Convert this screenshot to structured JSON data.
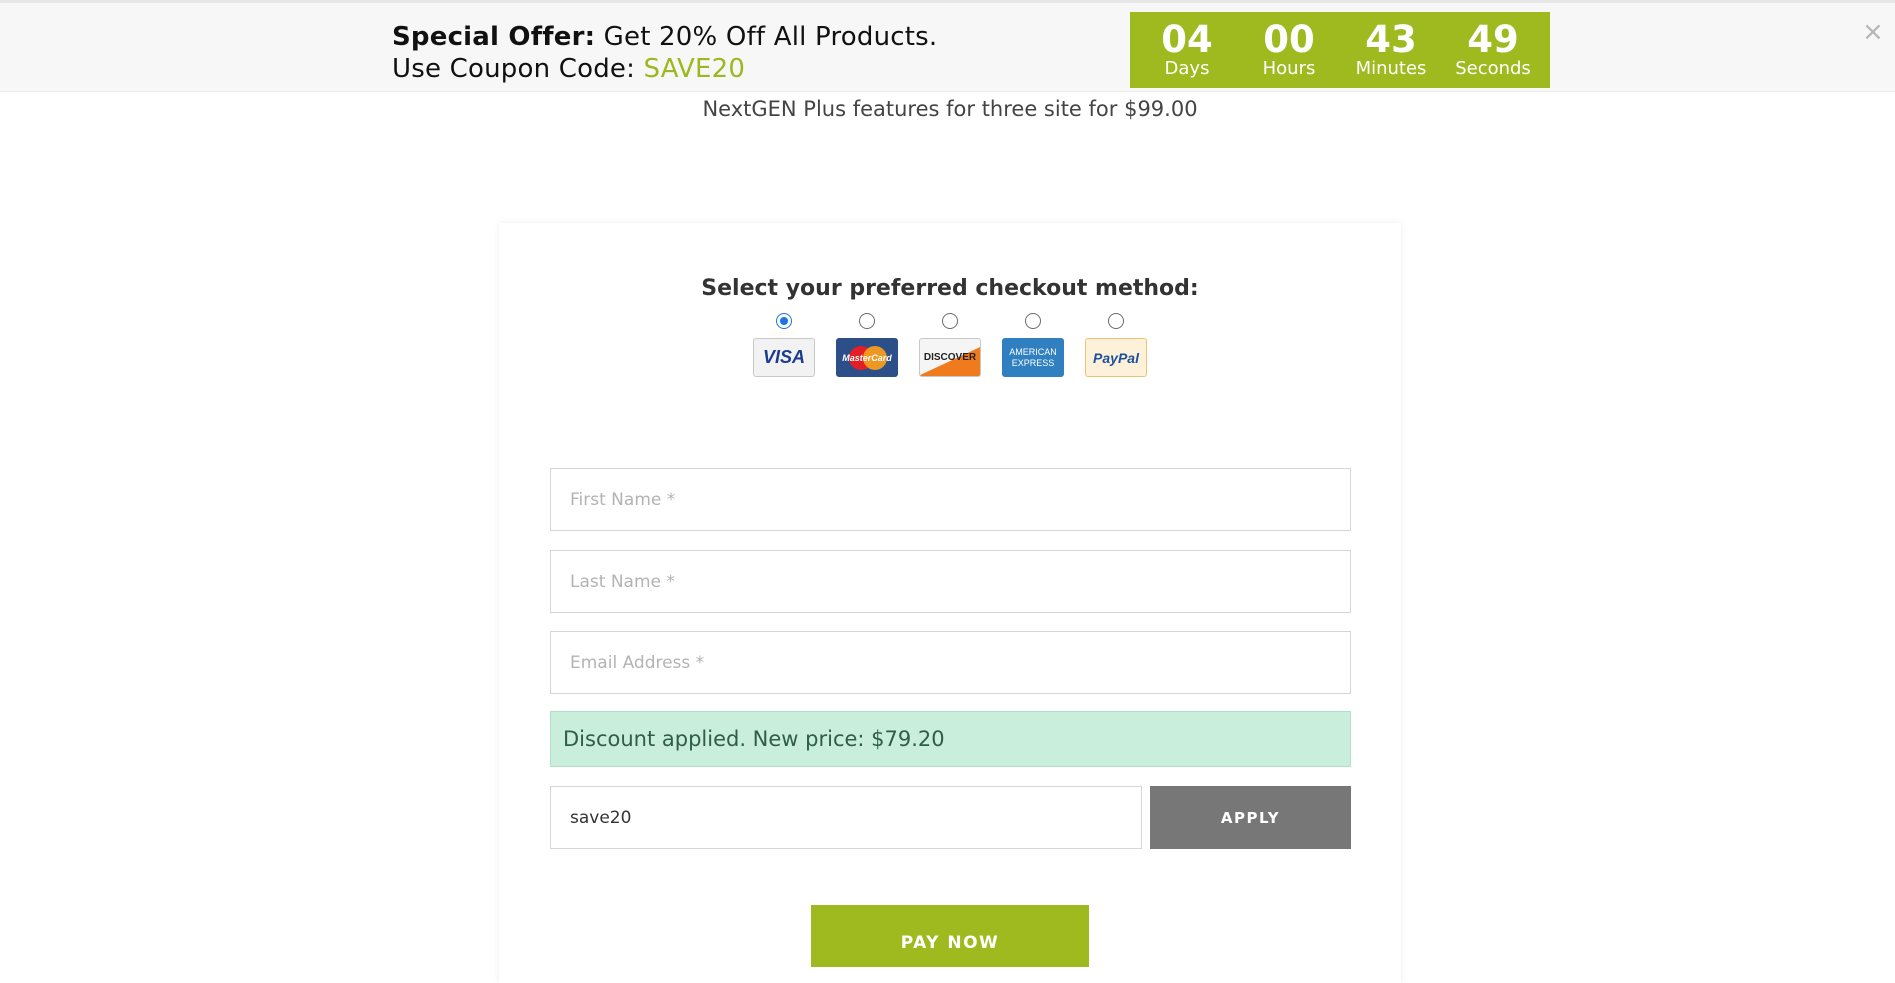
{
  "promo": {
    "offer_label": "Special Offer:",
    "offer_text": "Get 20% Off All Products.",
    "coupon_prefix": "Use Coupon Code:",
    "coupon_code": "SAVE20",
    "close_glyph": "×",
    "accent_color": "#9fba1f"
  },
  "countdown": [
    {
      "value": "04",
      "label": "Days"
    },
    {
      "value": "00",
      "label": "Hours"
    },
    {
      "value": "43",
      "label": "Minutes"
    },
    {
      "value": "49",
      "label": "Seconds"
    }
  ],
  "plan": {
    "subtitle": "NextGEN Plus features for three site for $99.00"
  },
  "checkout": {
    "title": "Select your preferred checkout method:",
    "methods": [
      {
        "name": "visa",
        "logo_text": "VISA",
        "selected": true
      },
      {
        "name": "mastercard",
        "logo_text": "MasterCard",
        "selected": false
      },
      {
        "name": "discover",
        "logo_text": "DISCOVER",
        "selected": false
      },
      {
        "name": "american-express",
        "logo_text": "AMERICAN EXPRESS",
        "selected": false
      },
      {
        "name": "paypal",
        "logo_text": "PayPal",
        "selected": false
      }
    ]
  },
  "form": {
    "first_name_placeholder": "First Name *",
    "last_name_placeholder": "Last Name *",
    "email_placeholder": "Email Address *",
    "discount_message": "Discount applied. New price: $79.20",
    "coupon_value": "save20",
    "apply_label": "APPLY",
    "pay_label": "PAY NOW"
  }
}
